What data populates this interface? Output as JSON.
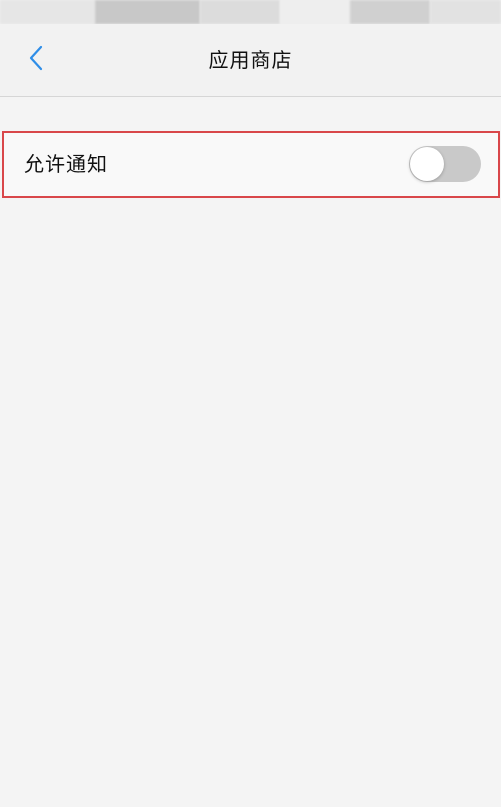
{
  "status_bar": {
    "note": ""
  },
  "nav": {
    "back_icon": "chevron-left-icon",
    "title": "应用商店"
  },
  "settings": {
    "allow_notifications": {
      "label": "允许通知",
      "enabled": false
    }
  },
  "colors": {
    "accent": "#2f8ee8",
    "highlight_border": "#d9474a",
    "toggle_off": "#c9c9c9",
    "background": "#f4f4f4"
  }
}
